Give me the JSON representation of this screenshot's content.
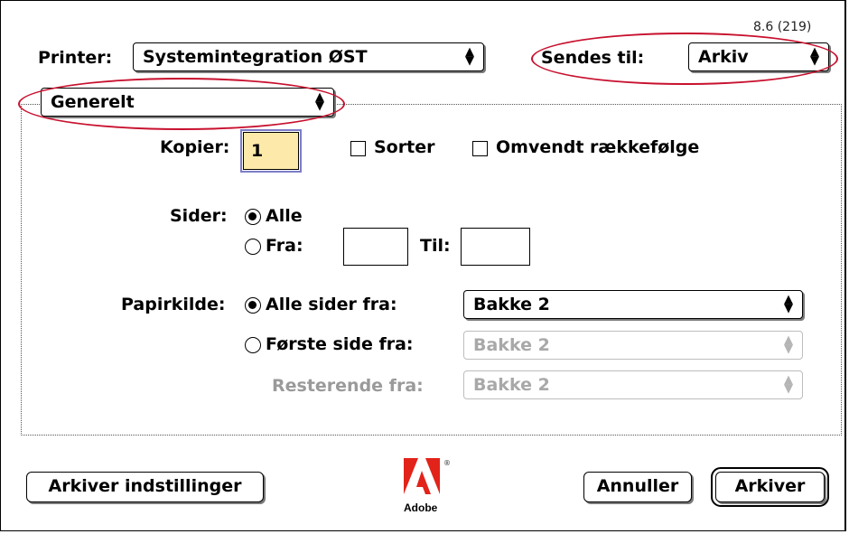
{
  "version": "8.6 (219)",
  "printer": {
    "label": "Printer:",
    "value": "Systemintegration ØST"
  },
  "destination": {
    "label": "Sendes til:",
    "value": "Arkiv"
  },
  "panel": {
    "value": "Generelt"
  },
  "copies": {
    "label": "Kopier:",
    "value": "1",
    "collate_label": "Sorter",
    "reverse_label": "Omvendt rækkefølge"
  },
  "pages": {
    "label": "Sider:",
    "all_label": "Alle",
    "from_label": "Fra:",
    "to_label": "Til:",
    "from_value": "",
    "to_value": ""
  },
  "paper": {
    "label": "Papirkilde:",
    "all_pages_label": "Alle sider fra:",
    "all_pages_value": "Bakke 2",
    "first_page_label": "Første side fra:",
    "first_page_value": "Bakke 2",
    "remaining_label": "Resterende fra:",
    "remaining_value": "Bakke 2"
  },
  "buttons": {
    "save_settings": "Arkiver indstillinger",
    "cancel": "Annuller",
    "save": "Arkiver"
  },
  "logo": {
    "text": "Adobe",
    "color": "#e2231a"
  },
  "highlight_color": "#c8102e"
}
